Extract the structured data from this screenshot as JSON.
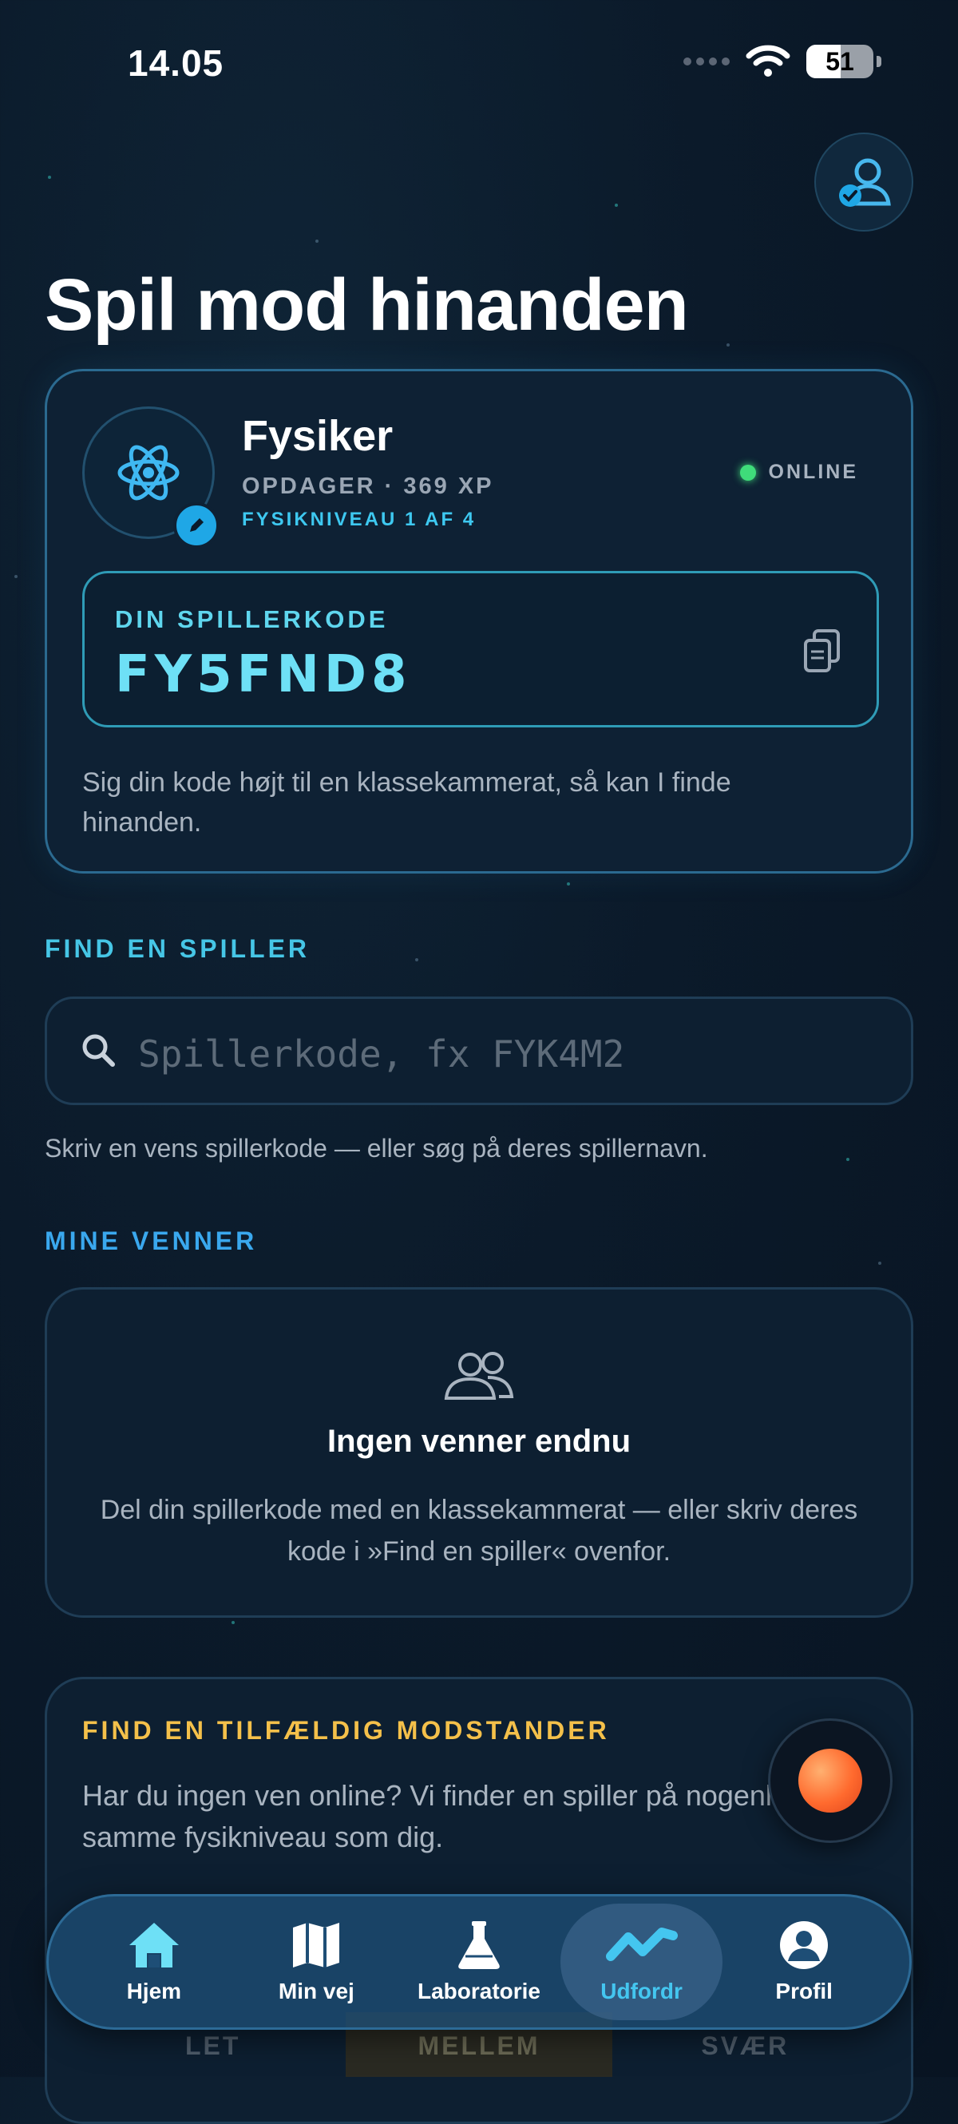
{
  "status_bar": {
    "time": "14.05",
    "battery": "51"
  },
  "page_title": "Spil mod hinanden",
  "player": {
    "name": "Fysiker",
    "rank": "OPDAGER · 369 XP",
    "level": "FYSIKNIVEAU 1 AF 4",
    "status": "ONLINE",
    "code_label": "DIN SPILLERKODE",
    "code": "FY5FND8",
    "hint": "Sig din kode højt til en klassekammerat, så kan I finde hinanden."
  },
  "find_player": {
    "label": "FIND EN SPILLER",
    "placeholder": "Spillerkode, fx FYK4M2",
    "value": "",
    "hint": "Skriv en vens spillerkode — eller søg på deres spillernavn."
  },
  "friends": {
    "label": "MINE VENNER",
    "empty_title": "Ingen venner endnu",
    "empty_desc": "Del din spillerkode med en klassekammerat — eller skriv deres kode i »Find en spiller« ovenfor."
  },
  "random_opponent": {
    "title": "FIND EN TILFÆLDIG MODSTANDER",
    "desc": "Har du ingen ven online? Vi finder en spiller på nogenlunde samme fysikniveau som dig.",
    "difficulties": [
      "LET",
      "MELLEM",
      "SVÆR"
    ]
  },
  "tabbar": {
    "items": [
      {
        "label": "Hjem",
        "icon": "home-icon"
      },
      {
        "label": "Min vej",
        "icon": "map-icon"
      },
      {
        "label": "Laboratorie",
        "icon": "flask-icon"
      },
      {
        "label": "Udfordr",
        "icon": "challenge-icon",
        "active": true
      },
      {
        "label": "Profil",
        "icon": "profile-icon"
      }
    ]
  },
  "colors": {
    "accent": "#44c6f0",
    "online": "#3fdc7a",
    "warning": "#f4c04a",
    "background": "#0b1a2a"
  }
}
